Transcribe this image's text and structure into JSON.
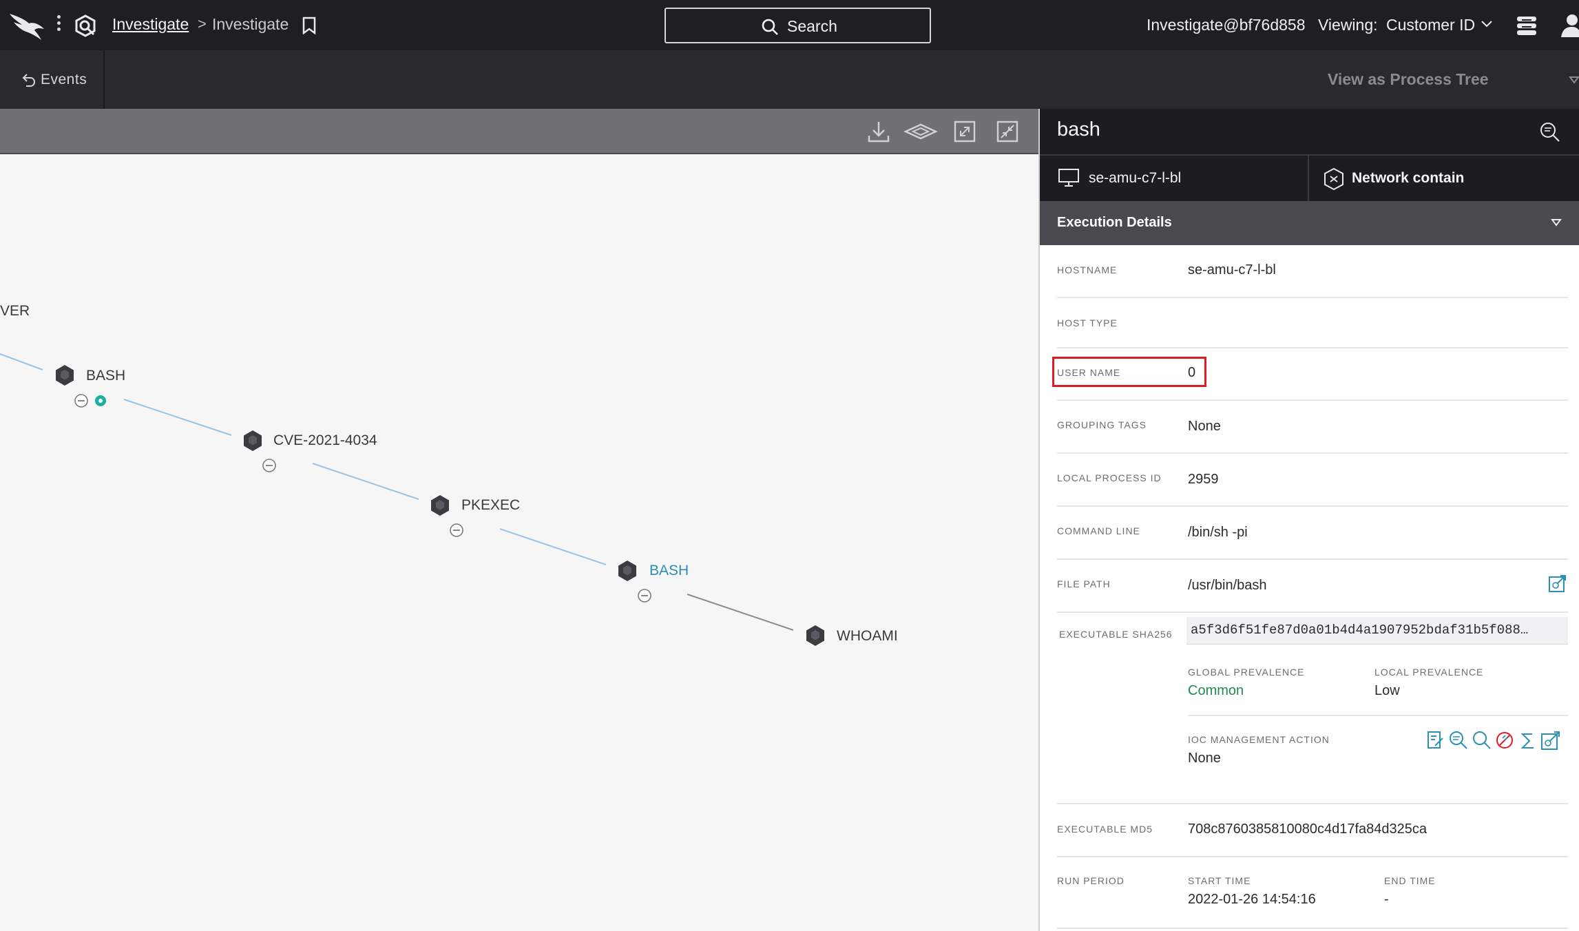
{
  "topbar": {
    "breadcrumb_link": "Investigate",
    "breadcrumb_sep": ">",
    "breadcrumb_current": "Investigate",
    "search_label": "Search",
    "user": "Investigate@bf76d858",
    "viewing_label": "Viewing:",
    "viewing_value": "Customer ID"
  },
  "subbar": {
    "events_label": "Events",
    "view_tree_label": "View as Process Tree"
  },
  "graph": {
    "nodes": [
      {
        "label": "VER"
      },
      {
        "label": "BASH"
      },
      {
        "label": "CVE-2021-4034"
      },
      {
        "label": "PKEXEC"
      },
      {
        "label": "BASH",
        "selected": true
      },
      {
        "label": "WHOAMI"
      }
    ],
    "colors": {
      "edge": "#9cc3e6",
      "edge_gray": "#8a8a8f",
      "node": "#3c3b40",
      "active": "#2b8fb8",
      "teal": "#1bb0a0"
    }
  },
  "panel": {
    "title": "bash",
    "host_action": "se-amu-c7-l-bl",
    "network_action": "Network contain",
    "section_title": "Execution Details",
    "fields": {
      "hostname_label": "HOSTNAME",
      "hostname_value": "se-amu-c7-l-bl",
      "hosttype_label": "HOST TYPE",
      "hosttype_value": "",
      "username_label": "USER NAME",
      "username_value": "0",
      "grouping_label": "GROUPING TAGS",
      "grouping_value": "None",
      "pid_label": "LOCAL PROCESS ID",
      "pid_value": "2959",
      "cmd_label": "COMMAND LINE",
      "cmd_value": "/bin/sh -pi",
      "filepath_label": "FILE PATH",
      "filepath_value": "/usr/bin/bash",
      "sha_label": "EXECUTABLE SHA256",
      "sha_value": "a5f3d6f51fe87d0a01b4d4a1907952bdaf31b5f088…",
      "global_prev_label": "GLOBAL PREVALENCE",
      "global_prev_value": "Common",
      "local_prev_label": "LOCAL PREVALENCE",
      "local_prev_value": "Low",
      "ioc_label": "IOC MANAGEMENT ACTION",
      "ioc_value": "None",
      "md5_label": "EXECUTABLE MD5",
      "md5_value": "708c8760385810080c4d17fa84d325ca",
      "runperiod_label": "RUN PERIOD",
      "start_label": "START TIME",
      "start_value": "2022-01-26 14:54:16",
      "end_label": "END TIME",
      "end_value": "-"
    }
  }
}
